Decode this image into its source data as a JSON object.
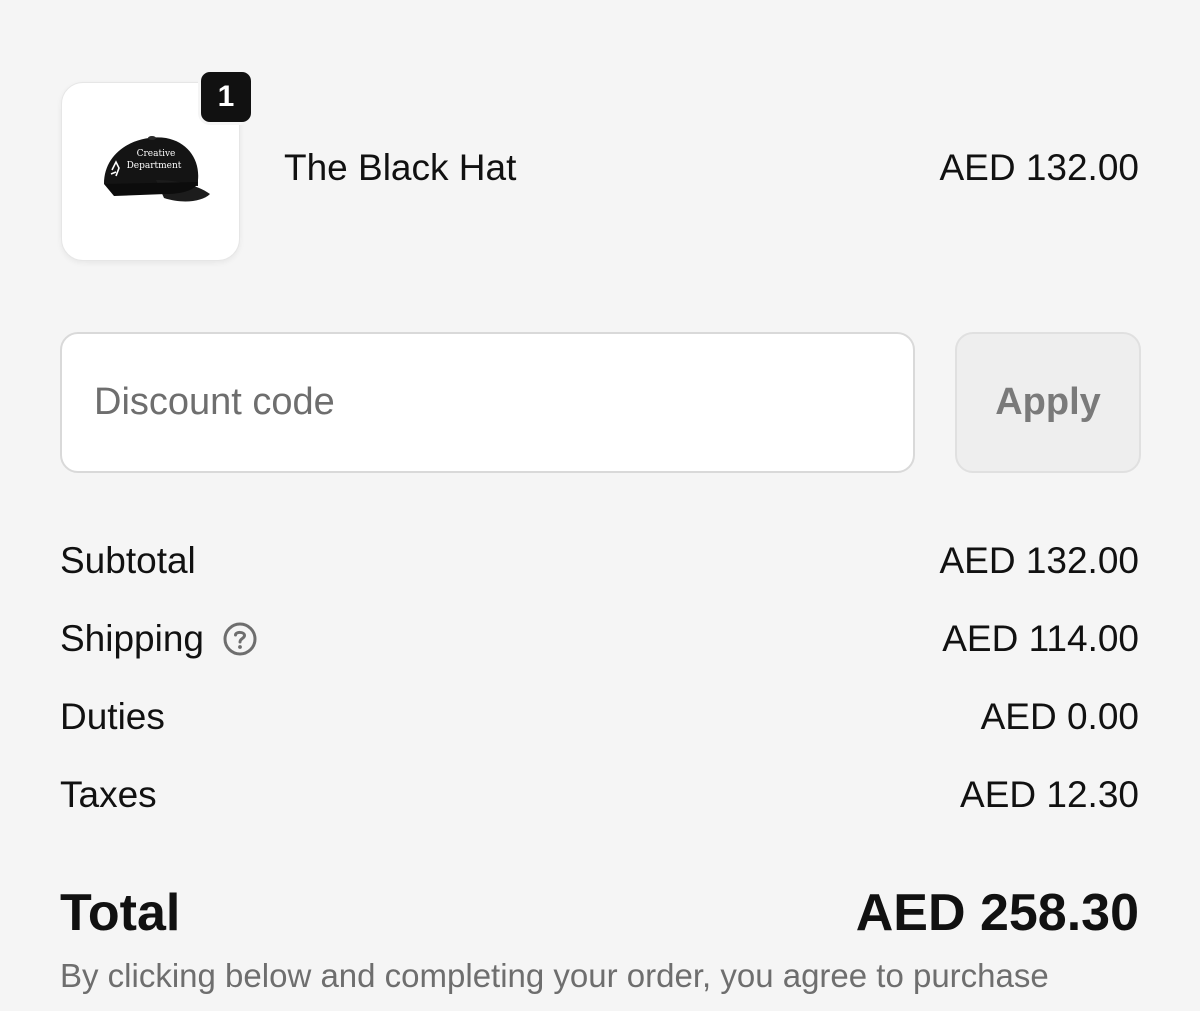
{
  "cart": {
    "item": {
      "quantity": "1",
      "name": "The Black Hat",
      "price": "AED 132.00",
      "image_icon": "black-cap-image",
      "hat_text_line1": "Creative",
      "hat_text_line2": "Department"
    }
  },
  "discount": {
    "placeholder": "Discount code",
    "value": "",
    "apply_label": "Apply"
  },
  "summary": {
    "subtotal_label": "Subtotal",
    "subtotal_value": "AED 132.00",
    "shipping_label": "Shipping",
    "shipping_help_icon": "question-circle-icon",
    "shipping_value": "AED 114.00",
    "duties_label": "Duties",
    "duties_value": "AED 0.00",
    "taxes_label": "Taxes",
    "taxes_value": "AED 12.30",
    "total_label": "Total",
    "total_value": "AED 258.30"
  },
  "disclaimer": "By clicking below and completing your order, you agree to purchase",
  "colors": {
    "background": "#f5f5f5",
    "text": "#111111",
    "muted_text": "#6e6e6e",
    "badge": "#111111",
    "button_bg": "#eeeeee"
  }
}
